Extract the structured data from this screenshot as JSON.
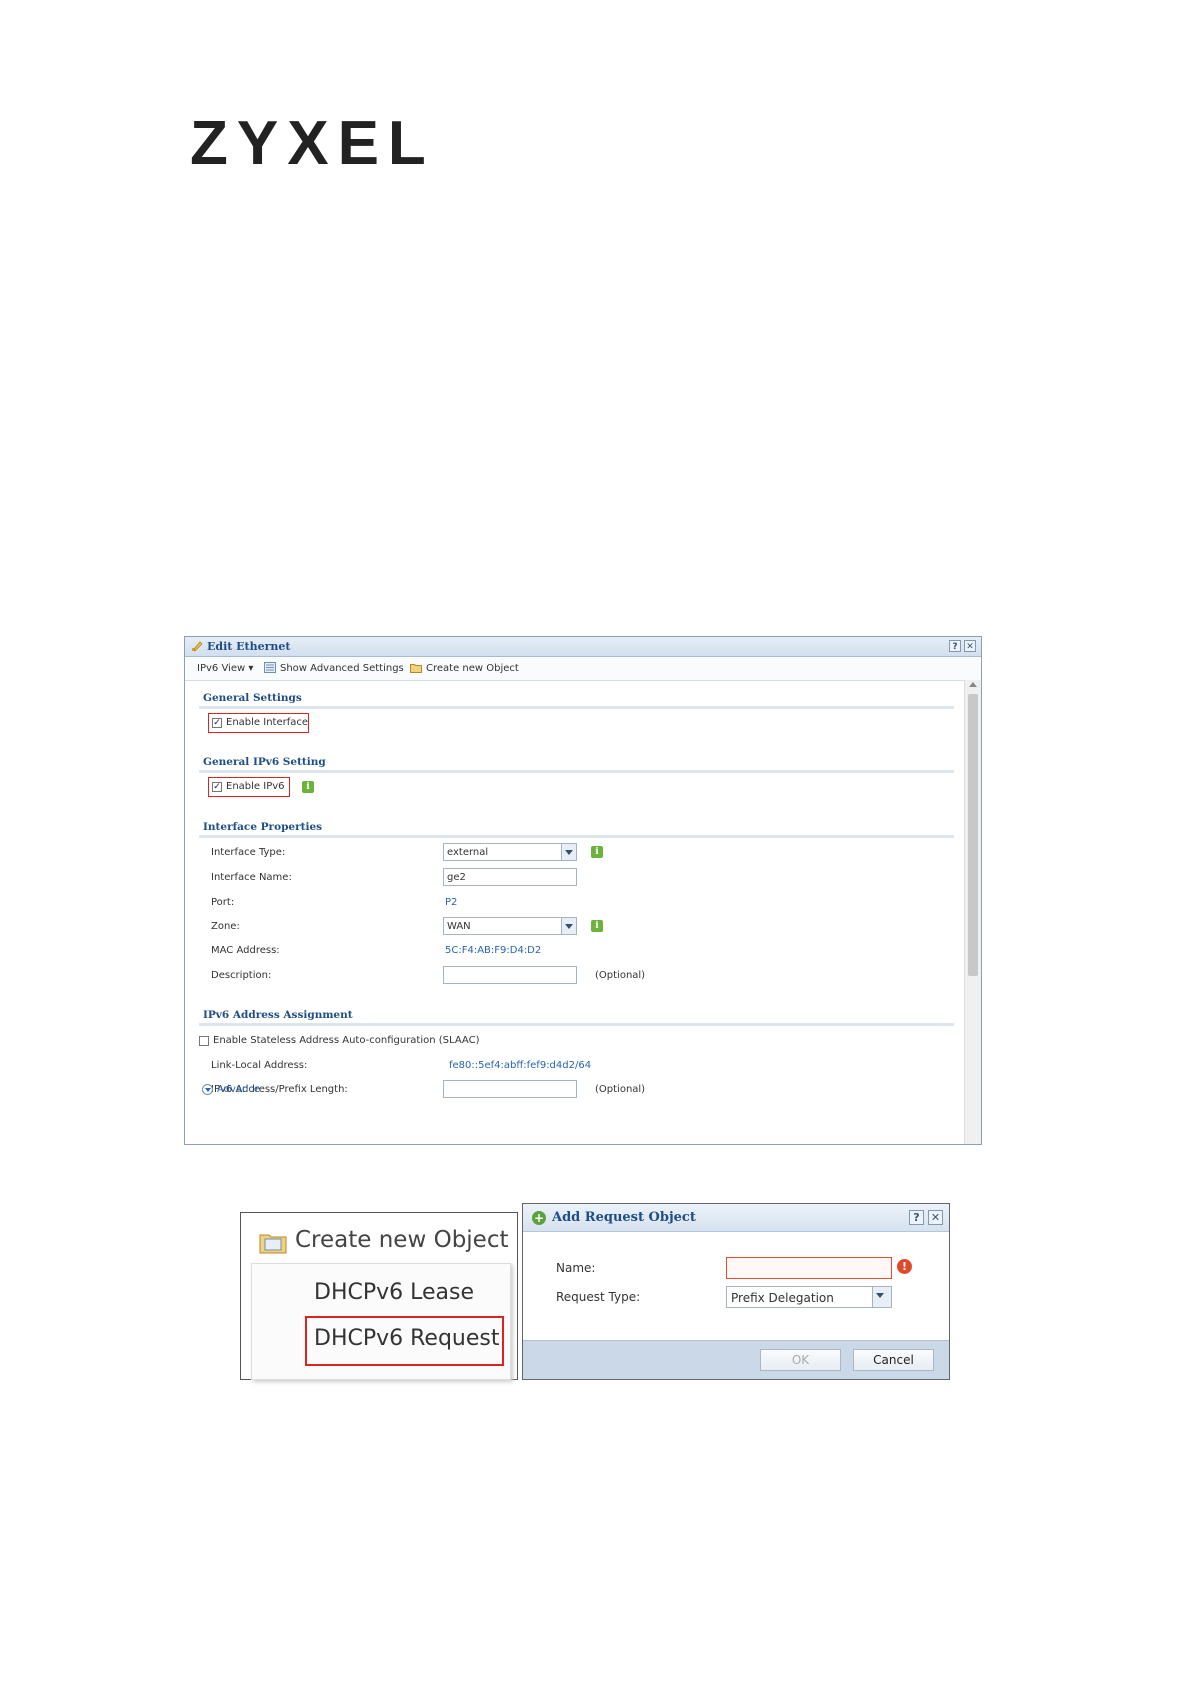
{
  "brand": {
    "logo": "ZYXEL"
  },
  "edit_window": {
    "title": "Edit Ethernet",
    "help_btn": "?",
    "close_btn": "✕",
    "toolbar": {
      "view_menu": "IPv6 View ▾",
      "show_advanced": "Show Advanced Settings",
      "create_object": "Create new Object"
    },
    "sections": {
      "general": "General Settings",
      "general_ipv6": "General IPv6 Setting",
      "interface_props": "Interface Properties",
      "ipv6_assign": "IPv6 Address Assignment"
    },
    "enable_interface": {
      "label": "Enable Interface",
      "checked": true
    },
    "enable_ipv6": {
      "label": "Enable IPv6",
      "checked": true
    },
    "fields": {
      "interface_type_label": "Interface Type:",
      "interface_type_value": "external",
      "interface_name_label": "Interface Name:",
      "interface_name_value": "ge2",
      "port_label": "Port:",
      "port_value": "P2",
      "zone_label": "Zone:",
      "zone_value": "WAN",
      "mac_label": "MAC Address:",
      "mac_value": "5C:F4:AB:F9:D4:D2",
      "description_label": "Description:",
      "description_value": "",
      "optional": "(Optional)",
      "slaac_label": "Enable Stateless Address Auto-configuration (SLAAC)",
      "slaac_checked": false,
      "link_local_label": "Link-Local Address:",
      "link_local_value": "fe80::5ef4:abff:fef9:d4d2/64",
      "ipv6_prefix_label": "IPv6 Address/Prefix Length:",
      "ipv6_prefix_value": ""
    },
    "advance_link": "Advance",
    "info_glyph": "i"
  },
  "create_menu": {
    "header": "Create new Object",
    "items": [
      "DHCPv6 Lease",
      "DHCPv6 Request"
    ]
  },
  "add_dialog": {
    "title": "Add Request Object",
    "name_label": "Name:",
    "name_value": "",
    "request_type_label": "Request Type:",
    "request_type_value": "Prefix Delegation",
    "ok": "OK",
    "cancel": "Cancel",
    "help_btn": "?",
    "close_btn": "✕",
    "error_glyph": "!",
    "plus_glyph": "+"
  },
  "colors": {
    "accent": "#1f4d86",
    "highlight": "#dd2222",
    "link": "#2a63b0"
  }
}
